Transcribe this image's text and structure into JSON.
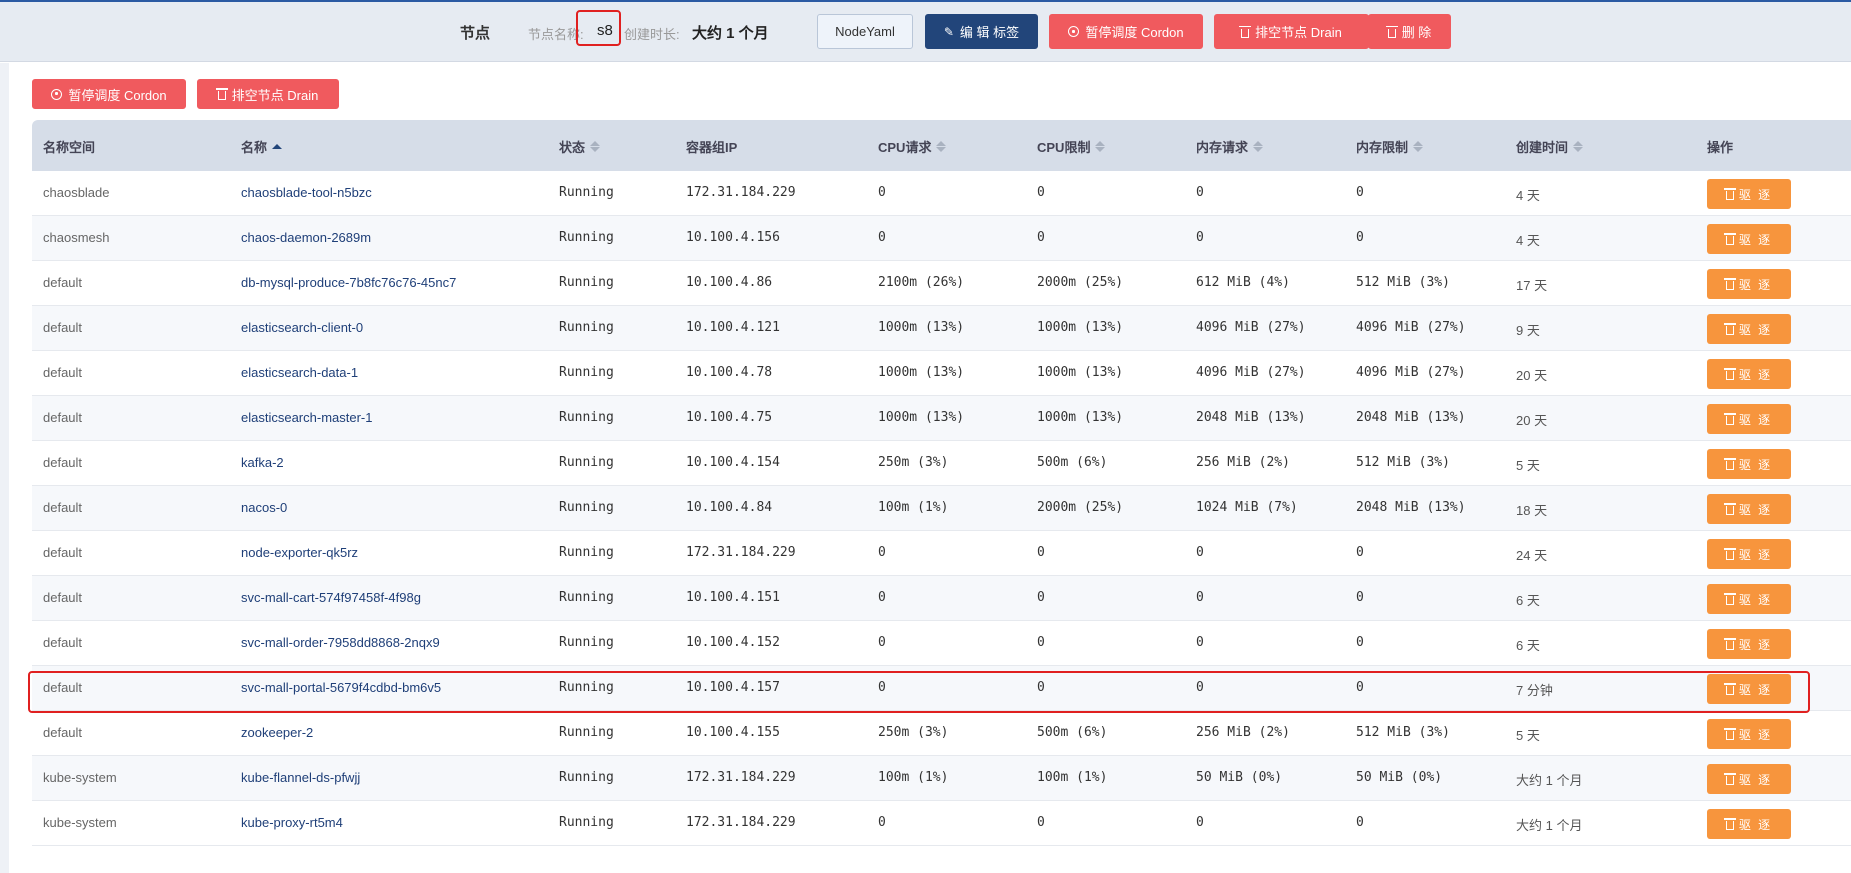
{
  "header": {
    "title": "节点",
    "node_name_label": "节点名称:",
    "node_name_value": "s8",
    "created_label": "创建时长:",
    "created_value": "大约 1 个月",
    "buttons": {
      "node_yaml": "NodeYaml",
      "edit_labels": "编 辑 标签",
      "cordon": "暂停调度 Cordon",
      "drain": "排空节点 Drain",
      "delete": "删 除"
    }
  },
  "toolbar": {
    "cordon": "暂停调度 Cordon",
    "drain": "排空节点 Drain"
  },
  "table": {
    "columns": [
      "名称空间",
      "名称",
      "状态",
      "容器组IP",
      "CPU请求",
      "CPU限制",
      "内存请求",
      "内存限制",
      "创建时间",
      "操作"
    ],
    "evict_label": "驱 逐",
    "rows": [
      {
        "ns": "chaosblade",
        "name": "chaosblade-tool-n5bzc",
        "status": "Running",
        "ip": "172.31.184.229",
        "cpu_req": "0",
        "cpu_lim": "0",
        "mem_req": "0",
        "mem_lim": "0",
        "age": "4 天"
      },
      {
        "ns": "chaosmesh",
        "name": "chaos-daemon-2689m",
        "status": "Running",
        "ip": "10.100.4.156",
        "cpu_req": "0",
        "cpu_lim": "0",
        "mem_req": "0",
        "mem_lim": "0",
        "age": "4 天"
      },
      {
        "ns": "default",
        "name": "db-mysql-produce-7b8fc76c76-45nc7",
        "status": "Running",
        "ip": "10.100.4.86",
        "cpu_req": "2100m (26%)",
        "cpu_lim": "2000m (25%)",
        "mem_req": "612 MiB (4%)",
        "mem_lim": "512 MiB (3%)",
        "age": "17 天"
      },
      {
        "ns": "default",
        "name": "elasticsearch-client-0",
        "status": "Running",
        "ip": "10.100.4.121",
        "cpu_req": "1000m (13%)",
        "cpu_lim": "1000m (13%)",
        "mem_req": "4096 MiB (27%)",
        "mem_lim": "4096 MiB (27%)",
        "age": "9 天"
      },
      {
        "ns": "default",
        "name": "elasticsearch-data-1",
        "status": "Running",
        "ip": "10.100.4.78",
        "cpu_req": "1000m (13%)",
        "cpu_lim": "1000m (13%)",
        "mem_req": "4096 MiB (27%)",
        "mem_lim": "4096 MiB (27%)",
        "age": "20 天"
      },
      {
        "ns": "default",
        "name": "elasticsearch-master-1",
        "status": "Running",
        "ip": "10.100.4.75",
        "cpu_req": "1000m (13%)",
        "cpu_lim": "1000m (13%)",
        "mem_req": "2048 MiB (13%)",
        "mem_lim": "2048 MiB (13%)",
        "age": "20 天"
      },
      {
        "ns": "default",
        "name": "kafka-2",
        "status": "Running",
        "ip": "10.100.4.154",
        "cpu_req": "250m (3%)",
        "cpu_lim": "500m (6%)",
        "mem_req": "256 MiB (2%)",
        "mem_lim": "512 MiB (3%)",
        "age": "5 天"
      },
      {
        "ns": "default",
        "name": "nacos-0",
        "status": "Running",
        "ip": "10.100.4.84",
        "cpu_req": "100m (1%)",
        "cpu_lim": "2000m (25%)",
        "mem_req": "1024 MiB (7%)",
        "mem_lim": "2048 MiB (13%)",
        "age": "18 天"
      },
      {
        "ns": "default",
        "name": "node-exporter-qk5rz",
        "status": "Running",
        "ip": "172.31.184.229",
        "cpu_req": "0",
        "cpu_lim": "0",
        "mem_req": "0",
        "mem_lim": "0",
        "age": "24 天"
      },
      {
        "ns": "default",
        "name": "svc-mall-cart-574f97458f-4f98g",
        "status": "Running",
        "ip": "10.100.4.151",
        "cpu_req": "0",
        "cpu_lim": "0",
        "mem_req": "0",
        "mem_lim": "0",
        "age": "6 天"
      },
      {
        "ns": "default",
        "name": "svc-mall-order-7958dd8868-2nqx9",
        "status": "Running",
        "ip": "10.100.4.152",
        "cpu_req": "0",
        "cpu_lim": "0",
        "mem_req": "0",
        "mem_lim": "0",
        "age": "6 天"
      },
      {
        "ns": "default",
        "name": "svc-mall-portal-5679f4cdbd-bm6v5",
        "status": "Running",
        "ip": "10.100.4.157",
        "cpu_req": "0",
        "cpu_lim": "0",
        "mem_req": "0",
        "mem_lim": "0",
        "age": "7 分钟"
      },
      {
        "ns": "default",
        "name": "zookeeper-2",
        "status": "Running",
        "ip": "10.100.4.155",
        "cpu_req": "250m (3%)",
        "cpu_lim": "500m (6%)",
        "mem_req": "256 MiB (2%)",
        "mem_lim": "512 MiB (3%)",
        "age": "5 天"
      },
      {
        "ns": "kube-system",
        "name": "kube-flannel-ds-pfwjj",
        "status": "Running",
        "ip": "172.31.184.229",
        "cpu_req": "100m (1%)",
        "cpu_lim": "100m (1%)",
        "mem_req": "50 MiB (0%)",
        "mem_lim": "50 MiB (0%)",
        "age": "大约 1 个月"
      },
      {
        "ns": "kube-system",
        "name": "kube-proxy-rt5m4",
        "status": "Running",
        "ip": "172.31.184.229",
        "cpu_req": "0",
        "cpu_lim": "0",
        "mem_req": "0",
        "mem_lim": "0",
        "age": "大约 1 个月"
      }
    ]
  },
  "colors": {
    "primary": "#22457a",
    "danger": "#f05a5e",
    "warning": "#f7953d",
    "highlight_box": "#e02020"
  }
}
